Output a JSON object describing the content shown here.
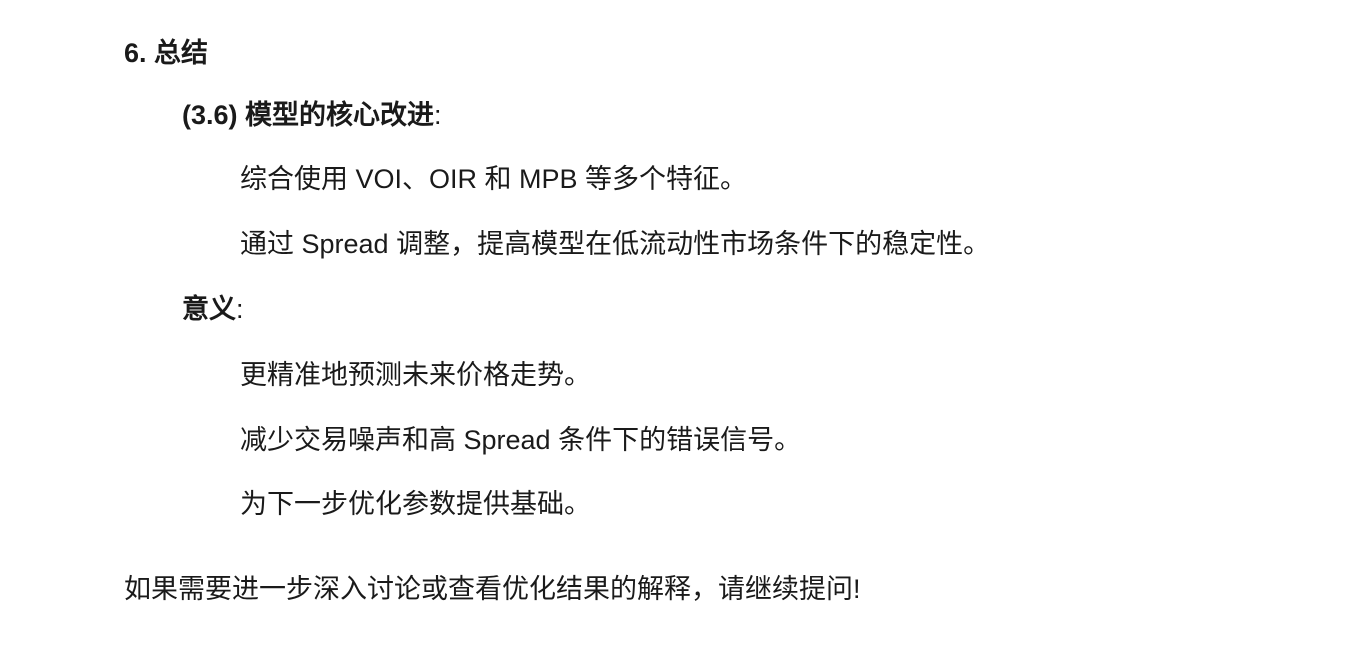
{
  "section": {
    "heading": "6. 总结"
  },
  "improvements": {
    "label": "(3.6) 模型的核心改进",
    "colon": ":",
    "items": [
      "综合使用 VOI、OIR 和 MPB 等多个特征。",
      "通过 Spread 调整，提高模型在低流动性市场条件下的稳定性。"
    ]
  },
  "significance": {
    "label": "意义",
    "colon": ":",
    "items": [
      "更精准地预测未来价格走势。",
      "减少交易噪声和高 Spread 条件下的错误信号。",
      "为下一步优化参数提供基础。"
    ]
  },
  "closing": "如果需要进一步深入讨论或查看优化结果的解释，请继续提问!"
}
